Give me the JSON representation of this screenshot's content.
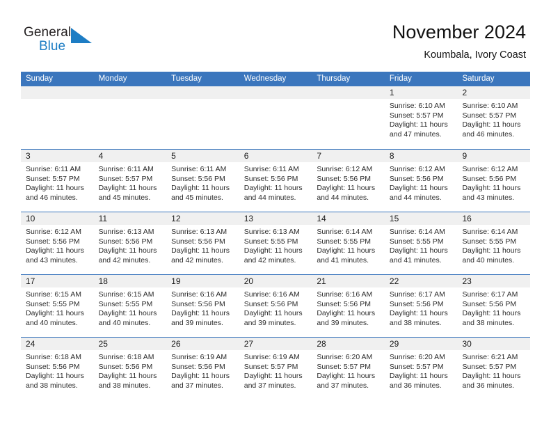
{
  "brand": {
    "name_part1": "General",
    "name_part2": "Blue",
    "triangle_color": "#1d7dc4",
    "text_color": "#231f20"
  },
  "header": {
    "title": "November 2024",
    "subtitle": "Koumbala, Ivory Coast"
  },
  "theme": {
    "header_blue": "#3b76bd",
    "day_band_gray": "#f0f0f0",
    "text_dark": "#2b2b2b"
  },
  "weekdays": [
    "Sunday",
    "Monday",
    "Tuesday",
    "Wednesday",
    "Thursday",
    "Friday",
    "Saturday"
  ],
  "weeks": [
    [
      {
        "day": "",
        "lines": []
      },
      {
        "day": "",
        "lines": []
      },
      {
        "day": "",
        "lines": []
      },
      {
        "day": "",
        "lines": []
      },
      {
        "day": "",
        "lines": []
      },
      {
        "day": "1",
        "lines": [
          "Sunrise: 6:10 AM",
          "Sunset: 5:57 PM",
          "Daylight: 11 hours",
          "and 47 minutes."
        ]
      },
      {
        "day": "2",
        "lines": [
          "Sunrise: 6:10 AM",
          "Sunset: 5:57 PM",
          "Daylight: 11 hours",
          "and 46 minutes."
        ]
      }
    ],
    [
      {
        "day": "3",
        "lines": [
          "Sunrise: 6:11 AM",
          "Sunset: 5:57 PM",
          "Daylight: 11 hours",
          "and 46 minutes."
        ]
      },
      {
        "day": "4",
        "lines": [
          "Sunrise: 6:11 AM",
          "Sunset: 5:57 PM",
          "Daylight: 11 hours",
          "and 45 minutes."
        ]
      },
      {
        "day": "5",
        "lines": [
          "Sunrise: 6:11 AM",
          "Sunset: 5:56 PM",
          "Daylight: 11 hours",
          "and 45 minutes."
        ]
      },
      {
        "day": "6",
        "lines": [
          "Sunrise: 6:11 AM",
          "Sunset: 5:56 PM",
          "Daylight: 11 hours",
          "and 44 minutes."
        ]
      },
      {
        "day": "7",
        "lines": [
          "Sunrise: 6:12 AM",
          "Sunset: 5:56 PM",
          "Daylight: 11 hours",
          "and 44 minutes."
        ]
      },
      {
        "day": "8",
        "lines": [
          "Sunrise: 6:12 AM",
          "Sunset: 5:56 PM",
          "Daylight: 11 hours",
          "and 44 minutes."
        ]
      },
      {
        "day": "9",
        "lines": [
          "Sunrise: 6:12 AM",
          "Sunset: 5:56 PM",
          "Daylight: 11 hours",
          "and 43 minutes."
        ]
      }
    ],
    [
      {
        "day": "10",
        "lines": [
          "Sunrise: 6:12 AM",
          "Sunset: 5:56 PM",
          "Daylight: 11 hours",
          "and 43 minutes."
        ]
      },
      {
        "day": "11",
        "lines": [
          "Sunrise: 6:13 AM",
          "Sunset: 5:56 PM",
          "Daylight: 11 hours",
          "and 42 minutes."
        ]
      },
      {
        "day": "12",
        "lines": [
          "Sunrise: 6:13 AM",
          "Sunset: 5:56 PM",
          "Daylight: 11 hours",
          "and 42 minutes."
        ]
      },
      {
        "day": "13",
        "lines": [
          "Sunrise: 6:13 AM",
          "Sunset: 5:55 PM",
          "Daylight: 11 hours",
          "and 42 minutes."
        ]
      },
      {
        "day": "14",
        "lines": [
          "Sunrise: 6:14 AM",
          "Sunset: 5:55 PM",
          "Daylight: 11 hours",
          "and 41 minutes."
        ]
      },
      {
        "day": "15",
        "lines": [
          "Sunrise: 6:14 AM",
          "Sunset: 5:55 PM",
          "Daylight: 11 hours",
          "and 41 minutes."
        ]
      },
      {
        "day": "16",
        "lines": [
          "Sunrise: 6:14 AM",
          "Sunset: 5:55 PM",
          "Daylight: 11 hours",
          "and 40 minutes."
        ]
      }
    ],
    [
      {
        "day": "17",
        "lines": [
          "Sunrise: 6:15 AM",
          "Sunset: 5:55 PM",
          "Daylight: 11 hours",
          "and 40 minutes."
        ]
      },
      {
        "day": "18",
        "lines": [
          "Sunrise: 6:15 AM",
          "Sunset: 5:55 PM",
          "Daylight: 11 hours",
          "and 40 minutes."
        ]
      },
      {
        "day": "19",
        "lines": [
          "Sunrise: 6:16 AM",
          "Sunset: 5:56 PM",
          "Daylight: 11 hours",
          "and 39 minutes."
        ]
      },
      {
        "day": "20",
        "lines": [
          "Sunrise: 6:16 AM",
          "Sunset: 5:56 PM",
          "Daylight: 11 hours",
          "and 39 minutes."
        ]
      },
      {
        "day": "21",
        "lines": [
          "Sunrise: 6:16 AM",
          "Sunset: 5:56 PM",
          "Daylight: 11 hours",
          "and 39 minutes."
        ]
      },
      {
        "day": "22",
        "lines": [
          "Sunrise: 6:17 AM",
          "Sunset: 5:56 PM",
          "Daylight: 11 hours",
          "and 38 minutes."
        ]
      },
      {
        "day": "23",
        "lines": [
          "Sunrise: 6:17 AM",
          "Sunset: 5:56 PM",
          "Daylight: 11 hours",
          "and 38 minutes."
        ]
      }
    ],
    [
      {
        "day": "24",
        "lines": [
          "Sunrise: 6:18 AM",
          "Sunset: 5:56 PM",
          "Daylight: 11 hours",
          "and 38 minutes."
        ]
      },
      {
        "day": "25",
        "lines": [
          "Sunrise: 6:18 AM",
          "Sunset: 5:56 PM",
          "Daylight: 11 hours",
          "and 38 minutes."
        ]
      },
      {
        "day": "26",
        "lines": [
          "Sunrise: 6:19 AM",
          "Sunset: 5:56 PM",
          "Daylight: 11 hours",
          "and 37 minutes."
        ]
      },
      {
        "day": "27",
        "lines": [
          "Sunrise: 6:19 AM",
          "Sunset: 5:57 PM",
          "Daylight: 11 hours",
          "and 37 minutes."
        ]
      },
      {
        "day": "28",
        "lines": [
          "Sunrise: 6:20 AM",
          "Sunset: 5:57 PM",
          "Daylight: 11 hours",
          "and 37 minutes."
        ]
      },
      {
        "day": "29",
        "lines": [
          "Sunrise: 6:20 AM",
          "Sunset: 5:57 PM",
          "Daylight: 11 hours",
          "and 36 minutes."
        ]
      },
      {
        "day": "30",
        "lines": [
          "Sunrise: 6:21 AM",
          "Sunset: 5:57 PM",
          "Daylight: 11 hours",
          "and 36 minutes."
        ]
      }
    ]
  ]
}
